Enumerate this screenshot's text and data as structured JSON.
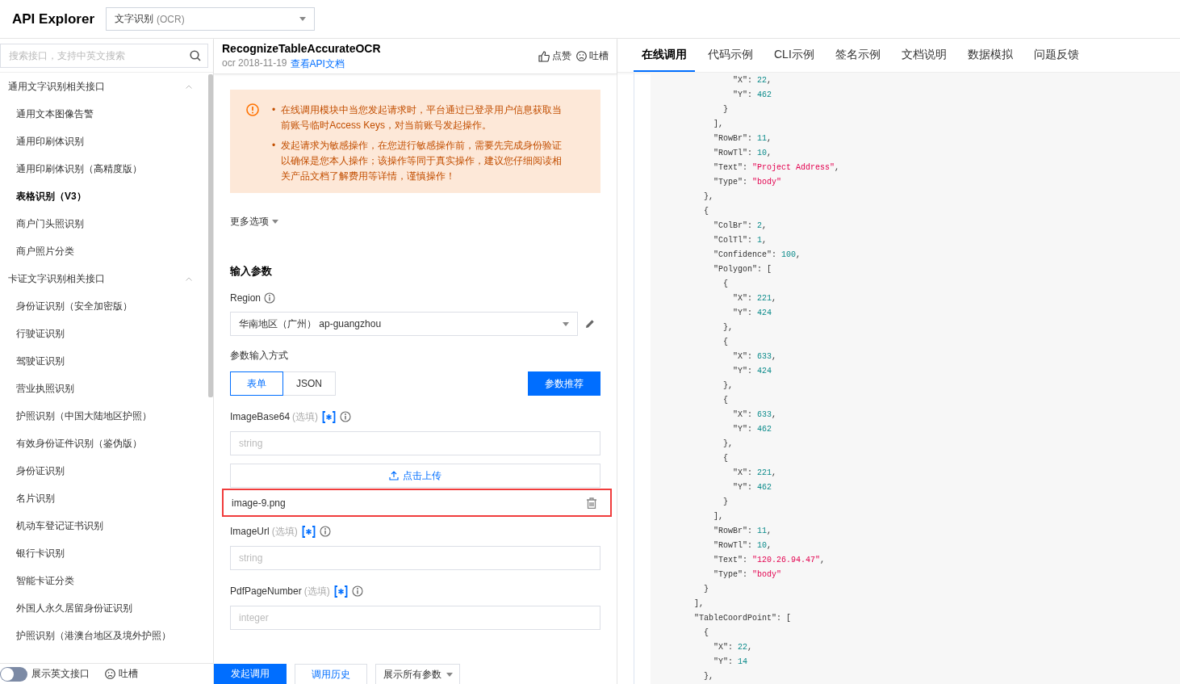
{
  "header": {
    "title": "API Explorer",
    "product_select": {
      "value": "文字识别",
      "hint": "(OCR)"
    }
  },
  "sidebar": {
    "search": {
      "placeholder": "搜索接口，支持中英文搜索"
    },
    "groups": [
      {
        "label": "通用文字识别相关接口",
        "expanded": true,
        "children": [
          {
            "label": "通用文本图像告警",
            "selected": false
          },
          {
            "label": "通用印刷体识别",
            "selected": false
          },
          {
            "label": "通用印刷体识别（高精度版）",
            "selected": false
          },
          {
            "label": "表格识别（V3）",
            "selected": true
          },
          {
            "label": "商户门头照识别",
            "selected": false
          },
          {
            "label": "商户照片分类",
            "selected": false
          }
        ]
      },
      {
        "label": "卡证文字识别相关接口",
        "expanded": true,
        "children": [
          {
            "label": "身份证识别（安全加密版）",
            "selected": false
          },
          {
            "label": "行驶证识别",
            "selected": false
          },
          {
            "label": "驾驶证识别",
            "selected": false
          },
          {
            "label": "营业执照识别",
            "selected": false
          },
          {
            "label": "护照识别（中国大陆地区护照）",
            "selected": false
          },
          {
            "label": "有效身份证件识别（鉴伪版）",
            "selected": false
          },
          {
            "label": "身份证识别",
            "selected": false
          },
          {
            "label": "名片识别",
            "selected": false
          },
          {
            "label": "机动车登记证书识别",
            "selected": false
          },
          {
            "label": "银行卡识别",
            "selected": false
          },
          {
            "label": "智能卡证分类",
            "selected": false
          },
          {
            "label": "外国人永久居留身份证识别",
            "selected": false
          },
          {
            "label": "护照识别（港澳台地区及境外护照）",
            "selected": false
          }
        ]
      }
    ],
    "footer": {
      "toggle": {
        "label": "展示英文接口",
        "on": false
      },
      "feedback": "吐槽"
    }
  },
  "api": {
    "name": "RecognizeTableAccurateOCR",
    "service": "ocr",
    "version": "2018-11-19",
    "doc_link": "查看API文档",
    "like": "点赞",
    "feedback": "吐槽"
  },
  "notice": [
    {
      "bullet": "•",
      "text": "在线调用模块中当您发起请求时，平台通过已登录用户信息获取当前账号临时Access Keys，对当前账号发起操作。"
    },
    {
      "bullet": "•",
      "text": "发起请求为敏感操作，在您进行敏感操作前，需要先完成身份验证以确保是您本人操作；该操作等同于真实操作，建议您仔细阅读相关产品文档了解费用等详情，谨慎操作！"
    }
  ],
  "more_options": "更多选项",
  "section_title": "输入参数",
  "region": {
    "label": "Region",
    "value": "华南地区（广州） ap-guangzhou"
  },
  "input_mode": {
    "label": "参数输入方式",
    "options": [
      {
        "label": "表单",
        "selected": true
      },
      {
        "label": "JSON",
        "selected": false
      }
    ],
    "recommend": "参数推荐"
  },
  "params": [
    {
      "name": "ImageBase64",
      "tag": "(选填)",
      "placeholder": "string",
      "upload": "点击上传",
      "file": {
        "name": "image-9.png",
        "highlighted": true
      }
    },
    {
      "name": "ImageUrl",
      "tag": "(选填)",
      "placeholder": "string"
    },
    {
      "name": "PdfPageNumber",
      "tag": "(选填)",
      "placeholder": "integer"
    }
  ],
  "actions": {
    "submit": "发起调用",
    "history": "调用历史",
    "show_all": "展示所有参数"
  },
  "tabs": [
    {
      "label": "在线调用",
      "selected": true
    },
    {
      "label": "代码示例",
      "selected": false
    },
    {
      "label": "CLI示例",
      "selected": false
    },
    {
      "label": "签名示例",
      "selected": false
    },
    {
      "label": "文档说明",
      "selected": false
    },
    {
      "label": "数据模拟",
      "selected": false
    },
    {
      "label": "问题反馈",
      "selected": false
    }
  ],
  "code": [
    {
      "children": [
        {
          "children": [
            {
              "children": [
                {
                  "children": [
                    {
                      "key": "\"X\":",
                      "value": "22",
                      "kind": "number",
                      "tail": ","
                    },
                    {
                      "key": "\"Y\":",
                      "value": "462",
                      "kind": "number"
                    }
                  ]
                },
                {
                  "text": "}"
                }
              ]
            },
            {
              "text": "],"
            },
            {
              "key": "\"RowBr\":",
              "value": "11",
              "kind": "number",
              "tail": ","
            },
            {
              "key": "\"RowTl\":",
              "value": "10",
              "kind": "number",
              "tail": ","
            },
            {
              "key": "\"Text\":",
              "value": "\"Project Address\"",
              "kind": "string",
              "tail": ","
            },
            {
              "key": "\"Type\":",
              "value": "\"body\"",
              "kind": "string"
            }
          ]
        },
        {
          "text": "},"
        },
        {
          "text": "{"
        },
        {
          "children": [
            {
              "key": "\"ColBr\":",
              "value": "2",
              "kind": "number",
              "tail": ","
            },
            {
              "key": "\"ColTl\":",
              "value": "1",
              "kind": "number",
              "tail": ","
            },
            {
              "key": "\"Confidence\":",
              "value": "100",
              "kind": "number",
              "tail": ","
            },
            {
              "key": "\"Polygon\":",
              "value": "["
            },
            {
              "children": [
                {
                  "text": "{"
                },
                {
                  "children": [
                    {
                      "key": "\"X\":",
                      "value": "221",
                      "kind": "number",
                      "tail": ","
                    },
                    {
                      "key": "\"Y\":",
                      "value": "424",
                      "kind": "number"
                    }
                  ]
                },
                {
                  "text": "},"
                },
                {
                  "text": "{"
                },
                {
                  "children": [
                    {
                      "key": "\"X\":",
                      "value": "633",
                      "kind": "number",
                      "tail": ","
                    },
                    {
                      "key": "\"Y\":",
                      "value": "424",
                      "kind": "number"
                    }
                  ]
                },
                {
                  "text": "},"
                },
                {
                  "text": "{"
                },
                {
                  "children": [
                    {
                      "key": "\"X\":",
                      "value": "633",
                      "kind": "number",
                      "tail": ","
                    },
                    {
                      "key": "\"Y\":",
                      "value": "462",
                      "kind": "number"
                    }
                  ]
                },
                {
                  "text": "},"
                },
                {
                  "text": "{"
                },
                {
                  "children": [
                    {
                      "key": "\"X\":",
                      "value": "221",
                      "kind": "number",
                      "tail": ","
                    },
                    {
                      "key": "\"Y\":",
                      "value": "462",
                      "kind": "number"
                    }
                  ]
                },
                {
                  "text": "}"
                }
              ]
            },
            {
              "text": "],"
            },
            {
              "key": "\"RowBr\":",
              "value": "11",
              "kind": "number",
              "tail": ","
            },
            {
              "key": "\"RowTl\":",
              "value": "10",
              "kind": "number",
              "tail": ","
            },
            {
              "key": "\"Text\":",
              "value": "\"120.26.94.47\"",
              "kind": "string",
              "tail": ","
            },
            {
              "key": "\"Type\":",
              "value": "\"body\"",
              "kind": "string"
            }
          ]
        },
        {
          "text": "}"
        }
      ]
    },
    {
      "text": "],"
    },
    {
      "key": "\"TableCoordPoint\":",
      "value": "["
    },
    {
      "children": [
        {
          "text": "{"
        },
        {
          "children": [
            {
              "key": "\"X\":",
              "value": "22",
              "kind": "number",
              "tail": ","
            },
            {
              "key": "\"Y\":",
              "value": "14",
              "kind": "number"
            }
          ]
        },
        {
          "text": "},"
        }
      ]
    }
  ]
}
